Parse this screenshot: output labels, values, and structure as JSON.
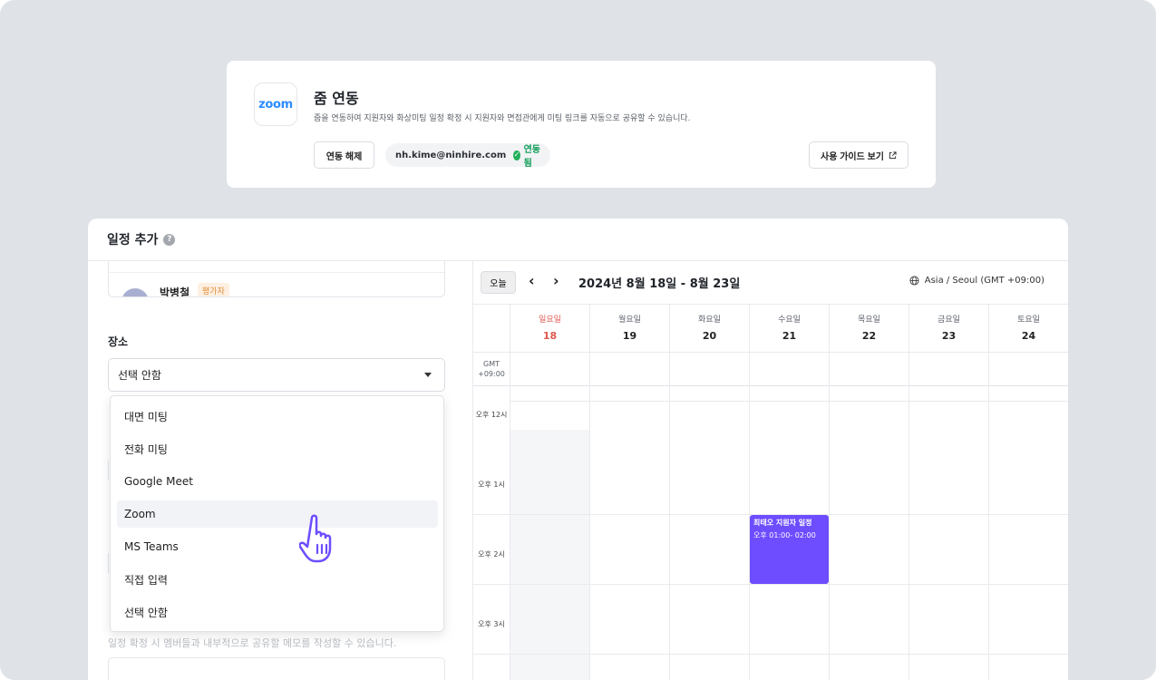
{
  "zoom_card": {
    "logo_text": "zoom",
    "title": "줌 연동",
    "description": "줌을 연동하여 지원자와 화상미팅 일정 확정 시 지원자와 면접관에게 미팅 링크를 자동으로 공유할 수 있습니다.",
    "unlink_label": "연동 해제",
    "account_email": "nh.kime@ninhire.com",
    "status_label": "연동됨",
    "guide_label": "사용 가이드 보기",
    "brand_color": "#2d8cff",
    "status_color": "#0f9d58"
  },
  "schedule": {
    "title": "일정 추가",
    "member": {
      "name": "박병철",
      "role": "평가자"
    },
    "place_label": "장소",
    "place_selected": "선택 안함",
    "memo_hint": "일정 확정 시 멤버들과 내부적으로 공유할 메모를 작성할 수 있습니다.",
    "dropdown_options": [
      "대면 미팅",
      "전화 미팅",
      "Google Meet",
      "Zoom",
      "MS Teams",
      "직접 입력",
      "선택 안함"
    ],
    "dropdown_hovered": "Zoom"
  },
  "calendar": {
    "today_label": "오늘",
    "prev_icon": "chevron-left-icon",
    "next_icon": "chevron-right-icon",
    "range_label": "2024년 8월 18일 - 8월 23일",
    "timezone_label": "Asia / Seoul (GMT +09:00)",
    "gmt_label_line1": "GMT",
    "gmt_label_line2": "+09:00",
    "days": [
      {
        "name": "일요일",
        "num": "18"
      },
      {
        "name": "월요일",
        "num": "19"
      },
      {
        "name": "화요일",
        "num": "20"
      },
      {
        "name": "수요일",
        "num": "21"
      },
      {
        "name": "목요일",
        "num": "22"
      },
      {
        "name": "금요일",
        "num": "23"
      },
      {
        "name": "토요일",
        "num": "24"
      }
    ],
    "time_labels": [
      "오후 12시",
      "오후 1시",
      "오후 2시",
      "오후 3시"
    ],
    "event": {
      "title": "최태오 지원자 일정",
      "time": "오후 01:00- 02:00",
      "color": "#6d4dff"
    },
    "sunday_color": "#e0584f"
  }
}
